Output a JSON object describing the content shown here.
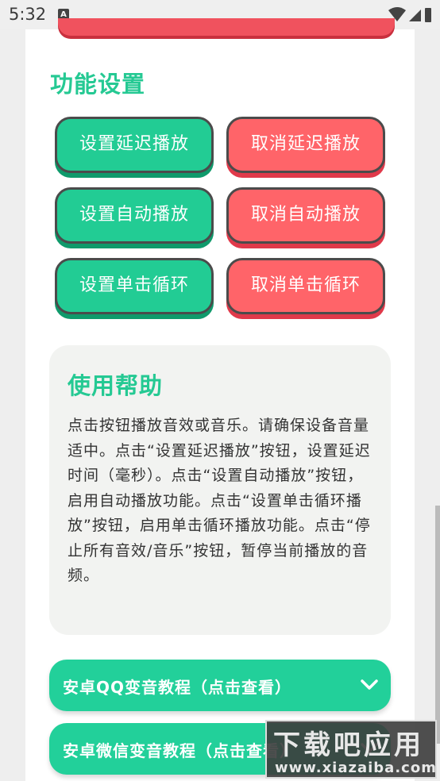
{
  "status_bar": {
    "time": "5:32",
    "notification_letter": "A"
  },
  "section": {
    "title": "功能设置"
  },
  "buttons": {
    "set_delay": "设置延迟播放",
    "cancel_delay": "取消延迟播放",
    "set_autoplay": "设置自动播放",
    "cancel_autoplay": "取消自动播放",
    "set_loop": "设置单击循环",
    "cancel_loop": "取消单击循环"
  },
  "help": {
    "title": "使用帮助",
    "text": "点击按钮播放音效或音乐。请确保设备音量适中。点击“设置延迟播放”按钮，设置延迟时间（毫秒）。点击“设置自动播放”按钮，启用自动播放功能。点击“设置单击循环播放”按钮，启用单击循环播放功能。点击“停止所有音效/音乐”按钮，暂停当前播放的音频。"
  },
  "accordions": [
    {
      "label": "安卓QQ变音教程（点击查看）",
      "icon": "chevron-down-icon"
    },
    {
      "label": "安卓微信变音教程（点击查看）",
      "icon": "chevron-down-icon"
    }
  ],
  "watermark": {
    "title": "下载吧应用",
    "url": "www.xiazaiba.com"
  },
  "colors": {
    "accent_green": "#22cc94",
    "accent_red": "#ff6469",
    "title_green": "#25c993"
  }
}
